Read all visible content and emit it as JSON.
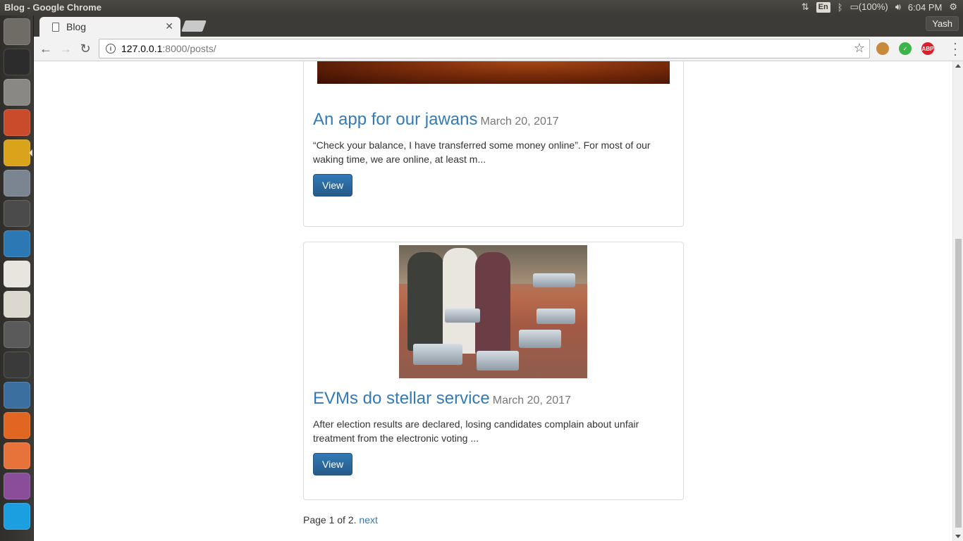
{
  "system": {
    "window_title": "Blog - Google Chrome",
    "keyboard_layout": "En",
    "battery": "(100%)",
    "clock": "6:04 PM"
  },
  "launcher": {
    "items": [
      {
        "name": "ubuntu-dash-icon",
        "color": "#6f6c66"
      },
      {
        "name": "terminal-icon",
        "color": "#2c2c2c"
      },
      {
        "name": "files-icon",
        "color": "#8a8885"
      },
      {
        "name": "system-settings-icon",
        "color": "#c94b2b"
      },
      {
        "name": "chrome-icon",
        "color": "#d9a31c"
      },
      {
        "name": "image-viewer-icon",
        "color": "#7a8591"
      },
      {
        "name": "sublime-text-icon",
        "color": "#4b4b4b"
      },
      {
        "name": "remote-desktop-icon",
        "color": "#2b78b5"
      },
      {
        "name": "pdf-viewer-icon",
        "color": "#e8e4de"
      },
      {
        "name": "text-editor-icon",
        "color": "#dcd8d0"
      },
      {
        "name": "software-updater-icon",
        "color": "#5a5a5a"
      },
      {
        "name": "color-app-icon",
        "color": "#3a3a3a"
      },
      {
        "name": "python-icon",
        "color": "#3a6fa0"
      },
      {
        "name": "firefox-icon",
        "color": "#e06622"
      },
      {
        "name": "software-center-icon",
        "color": "#e8733a"
      },
      {
        "name": "media-icon",
        "color": "#8a4d9a"
      },
      {
        "name": "skype-icon",
        "color": "#1c9fe0"
      }
    ]
  },
  "browser": {
    "tab_title": "Blog",
    "profile_name": "Yash",
    "url_host": "127.0.0.1",
    "url_rest": ":8000/posts/",
    "extensions": [
      {
        "name": "cookie-extension-icon",
        "color": "#c8893a",
        "label": ""
      },
      {
        "name": "check-extension-icon",
        "color": "#3bb54a",
        "label": "✓"
      },
      {
        "name": "adblock-extension-icon",
        "color": "#d8202a",
        "label": "ABP"
      }
    ]
  },
  "posts": [
    {
      "title": "An app for our jawans",
      "date": "March 20, 2017",
      "excerpt": "“Check your balance, I have transferred some money online”. For most of our waking time, we are online, at least m...",
      "button": "View"
    },
    {
      "title": "EVMs do stellar service",
      "date": "March 20, 2017",
      "excerpt": "After election results are declared, losing candidates complain about unfair treatment from the electronic voting ...",
      "button": "View"
    }
  ],
  "pagination": {
    "text": "Page 1 of 2.",
    "next": "next"
  }
}
